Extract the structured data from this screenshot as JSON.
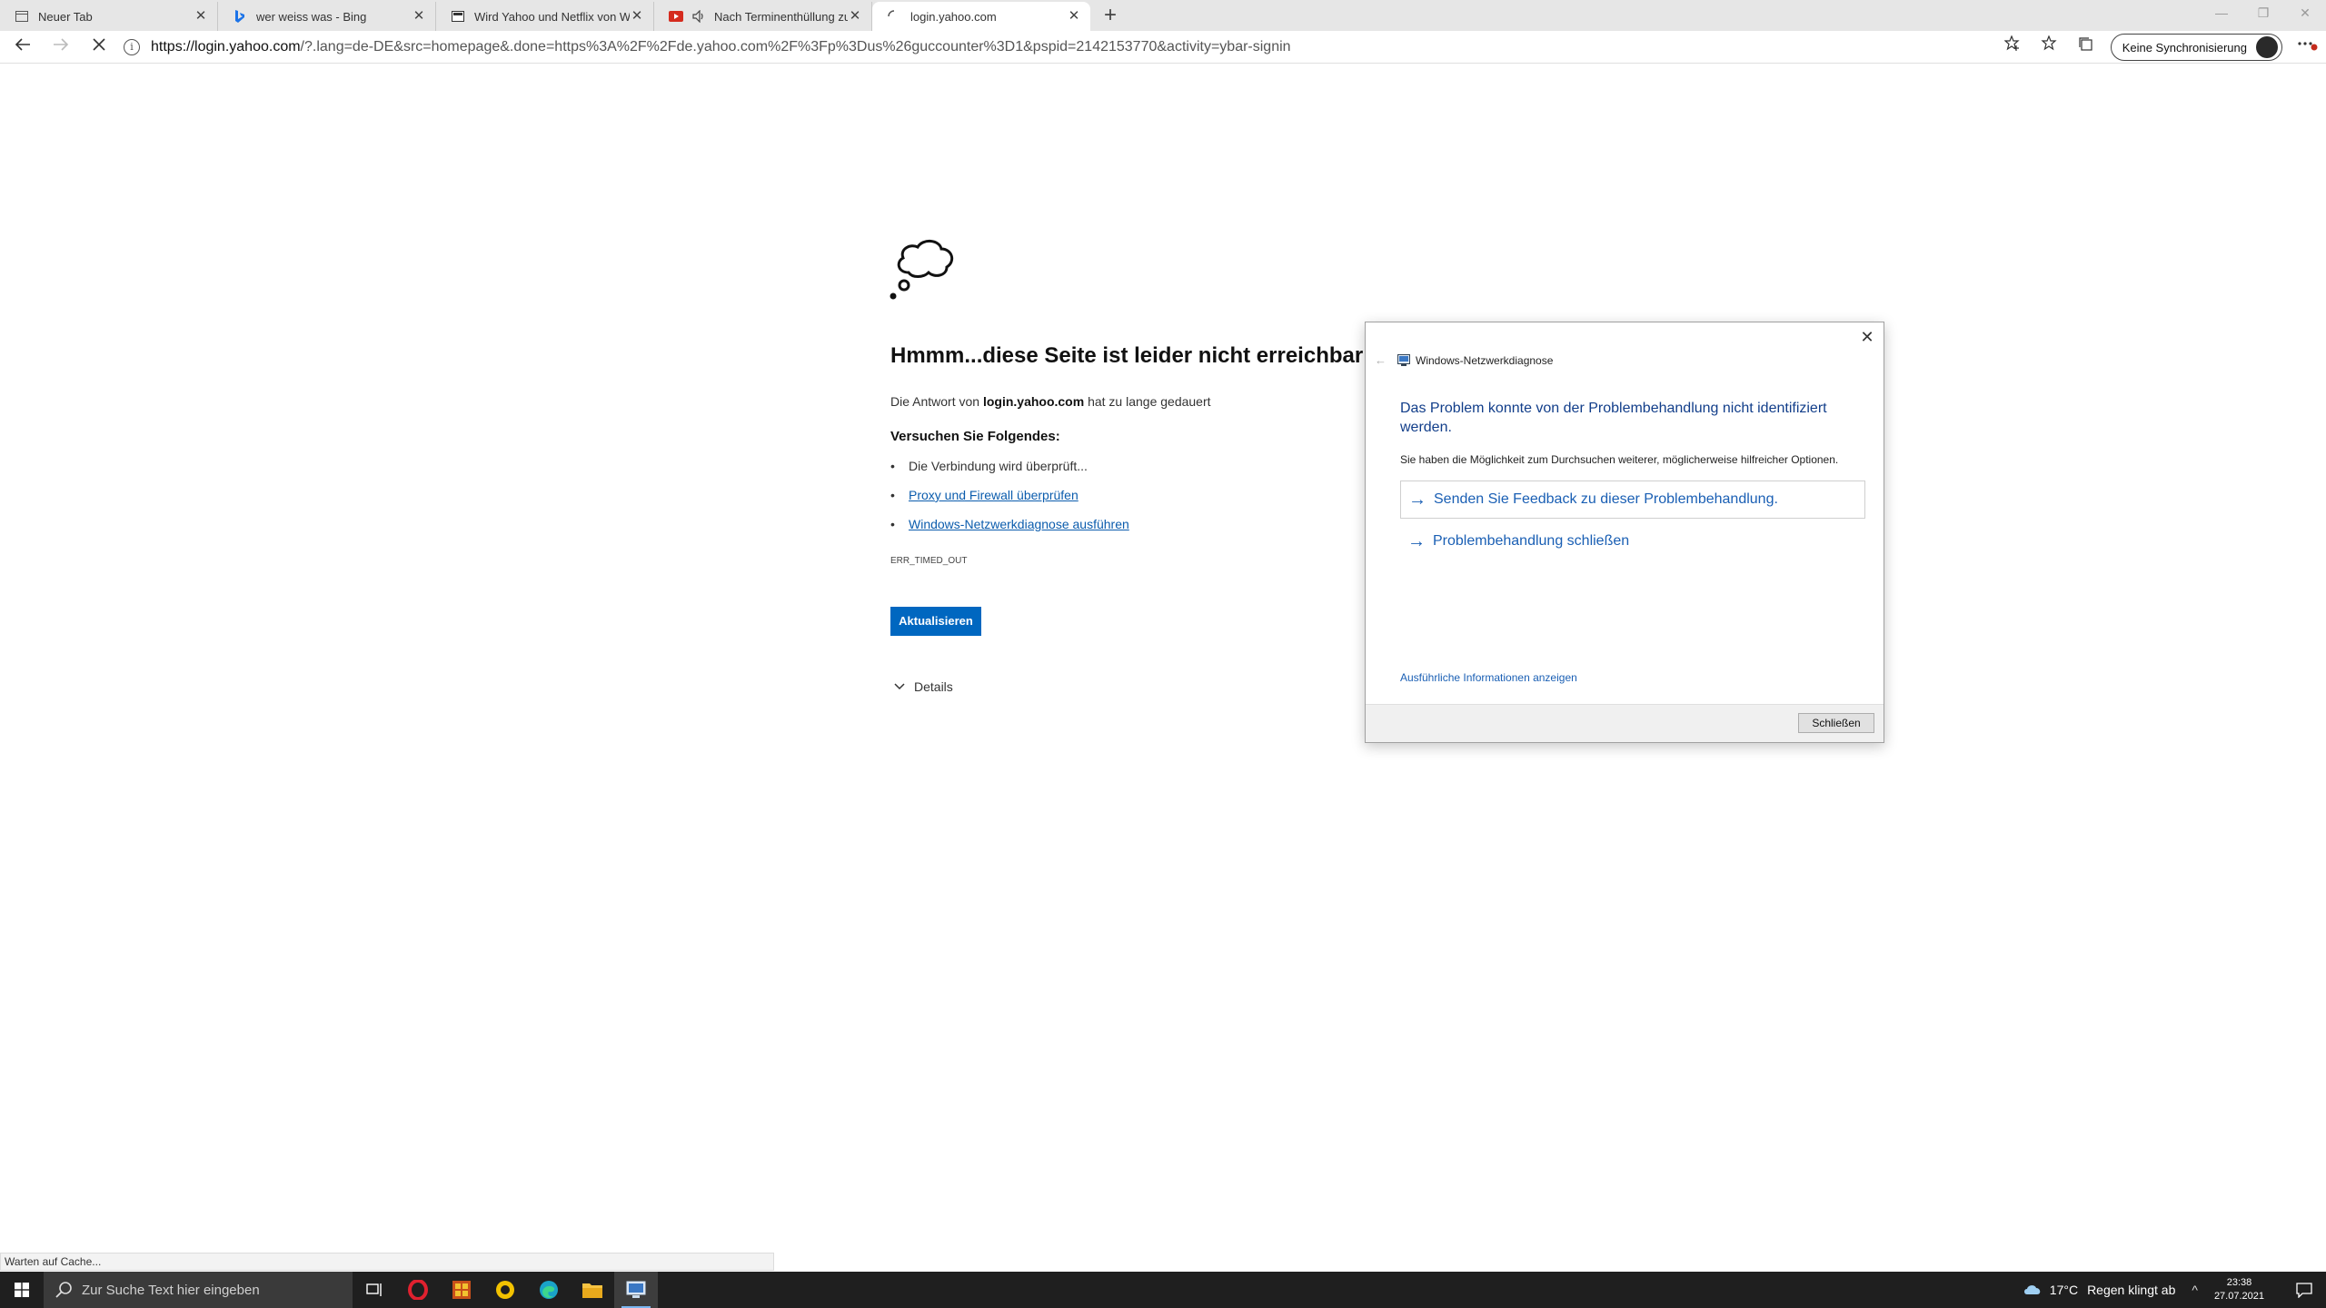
{
  "browser": {
    "tabs": [
      {
        "title": "Neuer Tab",
        "icon": "newtab-page-icon"
      },
      {
        "title": "wer weiss was - Bing",
        "icon": "bing-icon"
      },
      {
        "title": "Wird Yahoo und Netflix von Win",
        "icon": "page-icon"
      },
      {
        "title": "Nach Terminenthüllung zu",
        "icon": "video-icon"
      },
      {
        "title": "login.yahoo.com",
        "icon": "loading-spinner-icon"
      }
    ],
    "url_host": "https://login.yahoo.com",
    "url_rest": "/?.lang=de-DE&src=homepage&.done=https%3A%2F%2Fde.yahoo.com%2F%3Fp%3Dus%26guccounter%3D1&pspid=2142153770&activity=ybar-signin",
    "sync_label": "Keine Synchronisierung"
  },
  "error_page": {
    "title": "Hmmm...diese Seite ist leider nicht erreichbar",
    "desc_prefix": "Die Antwort von",
    "desc_host": "login.yahoo.com",
    "desc_suffix": "hat zu lange gedauert",
    "try_heading": "Versuchen Sie Folgendes:",
    "suggestions": {
      "check": "Die Verbindung wird überprüft...",
      "proxy": "Proxy und Firewall überprüfen",
      "diag": "Windows-Netzwerkdiagnose ausführen"
    },
    "error_code": "ERR_TIMED_OUT",
    "reload_label": "Aktualisieren",
    "details_label": "Details"
  },
  "dialog": {
    "window_title": "Windows-Netzwerkdiagnose",
    "message": "Das Problem konnte von der Problembehandlung nicht identifiziert werden.",
    "subtext": "Sie haben die Möglichkeit zum Durchsuchen weiterer, möglicherweise hilfreicher Optionen.",
    "option_feedback": "Senden Sie Feedback zu dieser Problembehandlung.",
    "option_close": "Problembehandlung schließen",
    "more_info": "Ausführliche Informationen anzeigen",
    "close_button": "Schließen"
  },
  "status_text": "Warten auf Cache...",
  "taskbar": {
    "search_placeholder": "Zur Suche Text hier eingeben",
    "apps": [
      "task-view-icon",
      "opera-icon",
      "app-grid-icon",
      "norton-icon",
      "edge-icon",
      "file-explorer-icon",
      "network-diagnostics-icon"
    ],
    "weather_temp": "17°C",
    "weather_desc": "Regen klingt ab",
    "time": "23:38",
    "date": "27.07.2021"
  },
  "colors": {
    "accent_blue": "#0067c0",
    "link_blue": "#0b5cad",
    "dialog_title_blue": "#123e8a",
    "taskbar": "#1f1f1f"
  }
}
